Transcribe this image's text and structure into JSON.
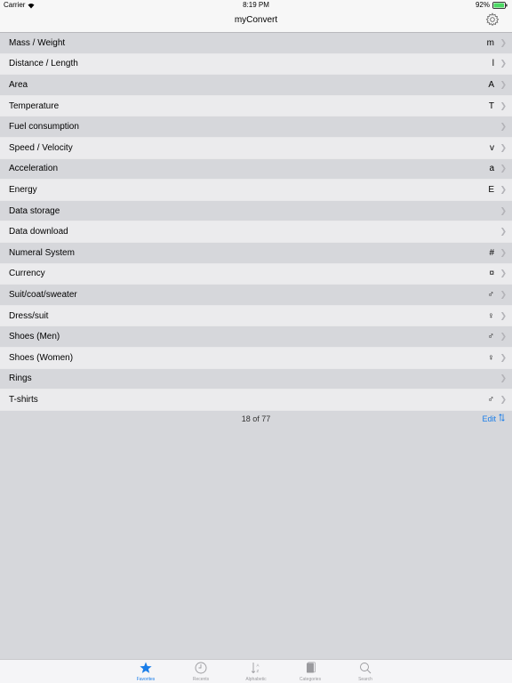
{
  "status": {
    "carrier": "Carrier",
    "time": "8:19 PM",
    "battery": "92%"
  },
  "nav": {
    "title": "myConvert",
    "settings_icon": "gear-icon"
  },
  "rows": [
    {
      "label": "Mass / Weight",
      "symbol": "m"
    },
    {
      "label": "Distance / Length",
      "symbol": "l"
    },
    {
      "label": "Area",
      "symbol": "A"
    },
    {
      "label": "Temperature",
      "symbol": "T"
    },
    {
      "label": "Fuel consumption",
      "symbol": ""
    },
    {
      "label": "Speed / Velocity",
      "symbol": "v"
    },
    {
      "label": "Acceleration",
      "symbol": "a"
    },
    {
      "label": "Energy",
      "symbol": "E"
    },
    {
      "label": "Data storage",
      "symbol": ""
    },
    {
      "label": "Data download",
      "symbol": ""
    },
    {
      "label": "Numeral System",
      "symbol": "#"
    },
    {
      "label": "Currency",
      "symbol": "¤"
    },
    {
      "label": "Suit/coat/sweater",
      "symbol": "♂"
    },
    {
      "label": "Dress/suit",
      "symbol": "♀"
    },
    {
      "label": "Shoes (Men)",
      "symbol": "♂"
    },
    {
      "label": "Shoes (Women)",
      "symbol": "♀"
    },
    {
      "label": "Rings",
      "symbol": ""
    },
    {
      "label": "T-shirts",
      "symbol": "♂"
    }
  ],
  "footer": {
    "count": "18 of 77",
    "edit": "Edit"
  },
  "tabs": {
    "favorites": "Favorites",
    "recents": "Recents",
    "alphabetic": "Alphabetic",
    "categories": "Categories",
    "search": "Search"
  },
  "colors": {
    "accent": "#1a7de8",
    "row_dark": "#d6d7db",
    "row_light": "#ebebed"
  }
}
